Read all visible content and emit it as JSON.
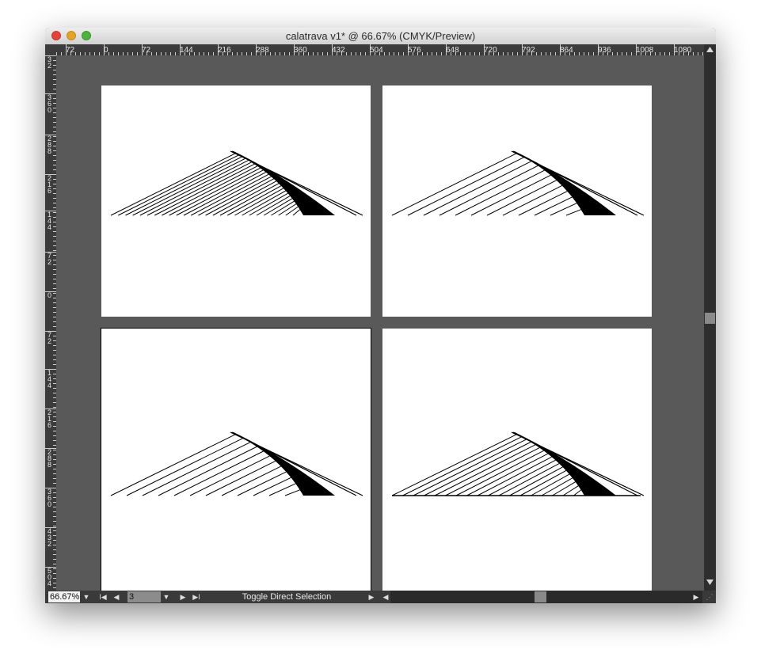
{
  "window": {
    "title": "calatrava v1* @ 66.67% (CMYK/Preview)"
  },
  "rulers": {
    "horizontal": [
      "72",
      "0",
      "72",
      "144",
      "216",
      "288",
      "360",
      "432",
      "504",
      "576",
      "648",
      "720",
      "792",
      "864",
      "936",
      "1008",
      "1080"
    ],
    "vertical": [
      "32",
      "360",
      "288",
      "216",
      "144",
      "72",
      "0",
      "72",
      "144",
      "216",
      "288",
      "360",
      "432",
      "504"
    ]
  },
  "statusbar": {
    "zoom": "66.67%",
    "page_number": "3",
    "status_text": "Toggle Direct Selection"
  },
  "icons": {
    "close": "close-button-icon",
    "minimize": "minimize-button-icon",
    "zoom": "zoom-button-icon",
    "first_page": "first-page-icon",
    "prev_page": "previous-page-icon",
    "next_page": "next-page-icon",
    "last_page": "last-page-icon"
  },
  "colors": {
    "pasteboard": "#595959",
    "ruler": "#3c3c3c",
    "artwork": "#000000"
  }
}
